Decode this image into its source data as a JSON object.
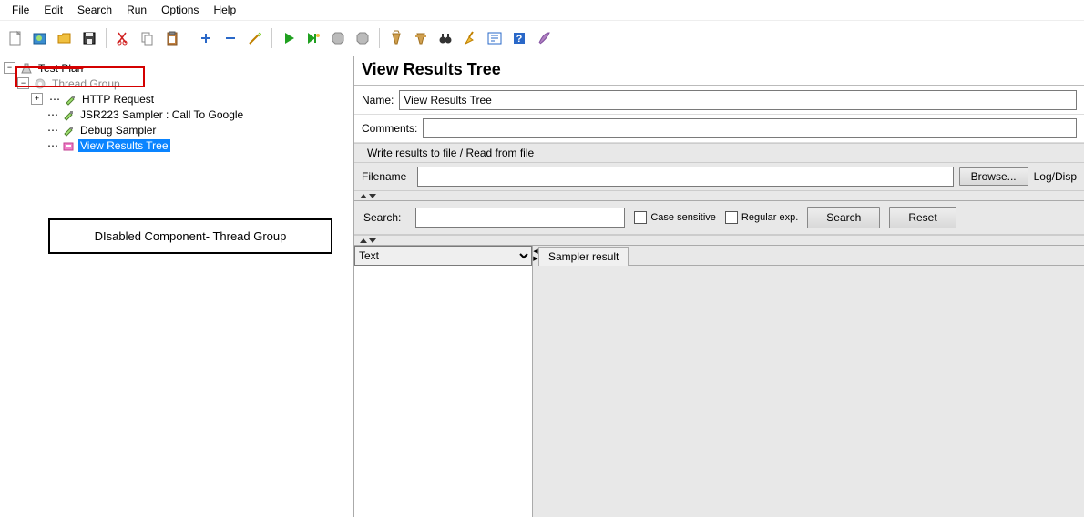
{
  "menu": [
    "File",
    "Edit",
    "Search",
    "Run",
    "Options",
    "Help"
  ],
  "toolbar_icons": [
    "new-file-icon",
    "templates-icon",
    "open-icon",
    "save-icon",
    "sep",
    "cut-icon",
    "copy-icon",
    "paste-icon",
    "sep",
    "plus-icon",
    "minus-icon",
    "wand-icon",
    "sep",
    "start-icon",
    "start-no-pause-icon",
    "stop-icon",
    "shutdown-icon",
    "sep",
    "clear-icon",
    "clear-all-icon",
    "binoculars-icon",
    "broom-icon",
    "function-helper-icon",
    "help-icon",
    "feather-icon"
  ],
  "tree": {
    "root": {
      "label": "Test Plan"
    },
    "thread_group": {
      "label": "Thread Group"
    },
    "children": [
      {
        "label": "HTTP Request"
      },
      {
        "label": "JSR223 Sampler : Call To Google"
      },
      {
        "label": "Debug Sampler"
      },
      {
        "label": "View Results Tree",
        "selected": true
      }
    ]
  },
  "callout_text": "DIsabled Component- Thread Group",
  "panel": {
    "title": "View Results Tree",
    "name_label": "Name:",
    "name_value": "View Results Tree",
    "comments_label": "Comments:",
    "file_section": "Write results to file / Read from file",
    "filename_label": "Filename",
    "browse_btn": "Browse...",
    "logdisplay_label": "Log/Disp",
    "search_label": "Search:",
    "case_sensitive": "Case sensitive",
    "regular_exp": "Regular exp.",
    "search_btn": "Search",
    "reset_btn": "Reset",
    "view_selector": "Text",
    "tab_sampler": "Sampler result"
  }
}
